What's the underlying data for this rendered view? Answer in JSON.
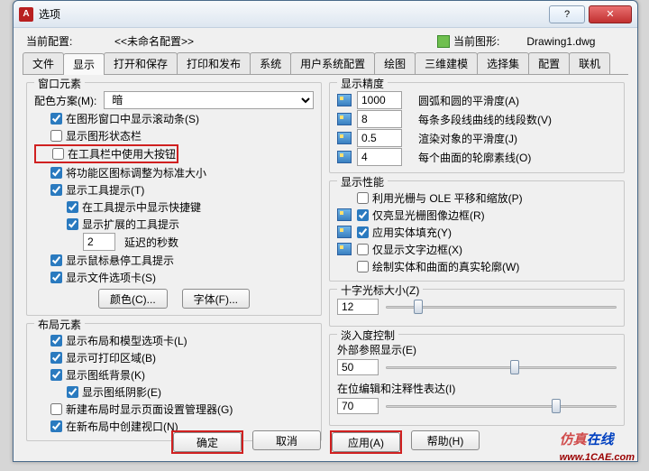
{
  "window": {
    "title": "选项"
  },
  "header": {
    "profile_label": "当前配置:",
    "profile_value": "<<未命名配置>>",
    "drawing_label": "当前图形:",
    "drawing_value": "Drawing1.dwg"
  },
  "tabs": [
    "文件",
    "显示",
    "打开和保存",
    "打印和发布",
    "系统",
    "用户系统配置",
    "绘图",
    "三维建模",
    "选择集",
    "配置",
    "联机"
  ],
  "active_tab": "显示",
  "panel": {
    "window_elements": {
      "legend": "窗口元素",
      "color_scheme_label": "配色方案(M):",
      "color_scheme_value": "暗",
      "items": {
        "scrollbars": "在图形窗口中显示滚动条(S)",
        "status_bar": "显示图形状态栏",
        "large_buttons": "在工具栏中使用大按钮",
        "resize_icons": "将功能区图标调整为标准大小",
        "tooltips": "显示工具提示(T)",
        "tooltip_shortcut": "在工具提示中显示快捷键",
        "ext_tooltip": "显示扩展的工具提示",
        "delay_label": "延迟的秒数",
        "delay_value": "2",
        "mouse_tooltip": "显示鼠标悬停工具提示",
        "file_tabs": "显示文件选项卡(S)"
      },
      "buttons": {
        "colors": "颜色(C)...",
        "fonts": "字体(F)..."
      }
    },
    "layout_elements": {
      "legend": "布局元素",
      "items": {
        "model_tabs": "显示布局和模型选项卡(L)",
        "print_area": "显示可打印区域(B)",
        "paper_bg": "显示图纸背景(K)",
        "paper_shadow": "显示图纸阴影(E)",
        "page_setup": "新建布局时显示页面设置管理器(G)",
        "viewport": "在新布局中创建视口(N)"
      }
    },
    "display_res": {
      "legend": "显示精度",
      "arc_smooth": {
        "value": "1000",
        "label": "圆弧和圆的平滑度(A)"
      },
      "polyline_segs": {
        "value": "8",
        "label": "每条多段线曲线的线段数(V)"
      },
      "render_smooth": {
        "value": "0.5",
        "label": "渲染对象的平滑度(J)"
      },
      "surf_contour": {
        "value": "4",
        "label": "每个曲面的轮廓素线(O)"
      }
    },
    "display_perf": {
      "legend": "显示性能",
      "items": {
        "ole_pan": "利用光栅与 OLE 平移和缩放(P)",
        "raster_frame": "仅亮显光栅图像边框(R)",
        "solid_fill": "应用实体填充(Y)",
        "text_frame": "仅显示文字边框(X)",
        "silhouette": "绘制实体和曲面的真实轮廓(W)"
      }
    },
    "crosshair": {
      "legend": "十字光标大小(Z)",
      "value": "12"
    },
    "fade": {
      "legend": "淡入度控制",
      "xref_label": "外部参照显示(E)",
      "xref_value": "50",
      "edit_label": "在位编辑和注释性表达(I)",
      "edit_value": "70"
    }
  },
  "footer": {
    "ok": "确定",
    "cancel": "取消",
    "apply": "应用(A)",
    "help": "帮助(H)"
  },
  "watermark": {
    "a": "仿真",
    "b": "在线",
    "c": "www.1CAE.com"
  }
}
